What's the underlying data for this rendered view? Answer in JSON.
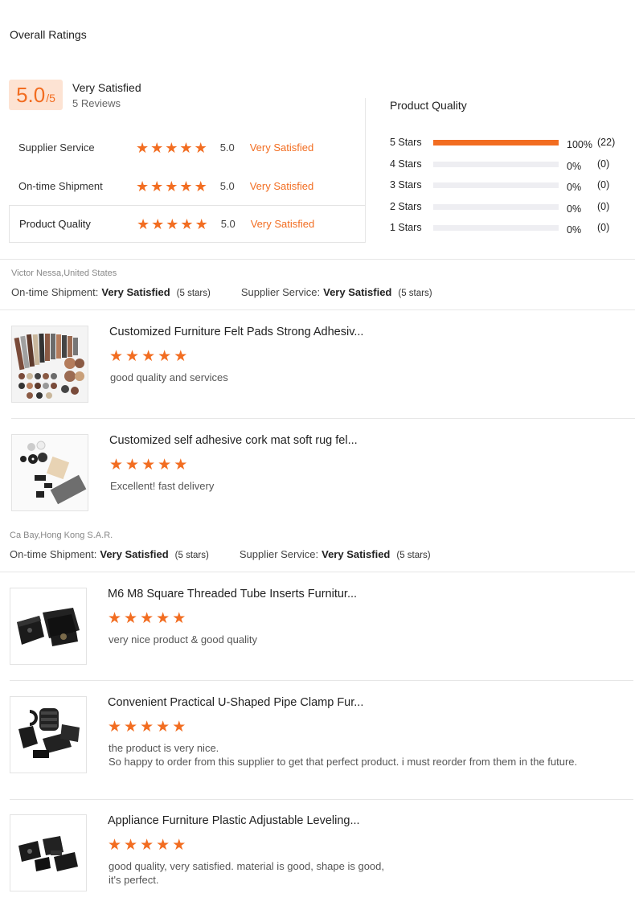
{
  "header": {
    "title": "Overall Ratings"
  },
  "summary": {
    "score": "5.0",
    "out_of": "/5",
    "label": "Very Satisfied",
    "reviews": "5 Reviews",
    "accent": "#f26d21"
  },
  "categories": [
    {
      "name": "Supplier Service",
      "stars": 5,
      "score": "5.0",
      "text": "Very Satisfied"
    },
    {
      "name": "On-time Shipment",
      "stars": 5,
      "score": "5.0",
      "text": "Very Satisfied"
    },
    {
      "name": "Product Quality",
      "stars": 5,
      "score": "5.0",
      "text": "Very Satisfied"
    }
  ],
  "distribution": {
    "title": "Product Quality",
    "rows": [
      {
        "label": "5 Stars",
        "fraction": 1.0,
        "pct": "100%",
        "count": "(22)"
      },
      {
        "label": "4 Stars",
        "fraction": 0,
        "pct": "0%",
        "count": "(0)"
      },
      {
        "label": "3 Stars",
        "fraction": 0,
        "pct": "0%",
        "count": "(0)"
      },
      {
        "label": "2 Stars",
        "fraction": 0,
        "pct": "0%",
        "count": "(0)"
      },
      {
        "label": "1 Stars",
        "fraction": 0,
        "pct": "0%",
        "count": "(0)"
      }
    ]
  },
  "reviews": [
    {
      "reviewer": "Victor Nessa,United States",
      "shipment_key": "On-time Shipment:",
      "shipment_val": "Very Satisfied",
      "shipment_stars": "(5 stars)",
      "service_key": "Supplier Service:",
      "service_val": "Very Satisfied",
      "service_stars": "(5 stars)",
      "items": [
        {
          "title": "Customized Furniture Felt Pads Strong Adhesiv...",
          "stars": 5,
          "text": "good quality and services",
          "image": "felt-pads-image"
        },
        {
          "title": "Customized self adhesive cork mat soft rug fel...",
          "stars": 5,
          "text": "Excellent! fast delivery",
          "image": "cork-mat-image"
        }
      ]
    },
    {
      "reviewer": "Ca Bay,Hong Kong S.A.R.",
      "shipment_key": "On-time Shipment:",
      "shipment_val": "Very Satisfied",
      "shipment_stars": "(5 stars)",
      "service_key": "Supplier Service:",
      "service_val": "Very Satisfied",
      "service_stars": "(5 stars)",
      "items": [
        {
          "title": "M6 M8 Square Threaded Tube Inserts Furnitur...",
          "stars": 5,
          "text": "very nice product & good quality",
          "image": "tube-inserts-image"
        },
        {
          "title": "Convenient Practical U-Shaped Pipe Clamp Fur...",
          "stars": 5,
          "text": "the product is very nice.",
          "text2": "So happy to order from this supplier to get that perfect product. i must reorder from them in the future.",
          "image": "pipe-clamp-image"
        },
        {
          "title": "Appliance Furniture Plastic Adjustable Leveling...",
          "stars": 5,
          "text": "good quality, very satisfied. material is good, shape is good,",
          "text2": "it's perfect.",
          "image": "leveling-feet-image"
        }
      ]
    }
  ]
}
